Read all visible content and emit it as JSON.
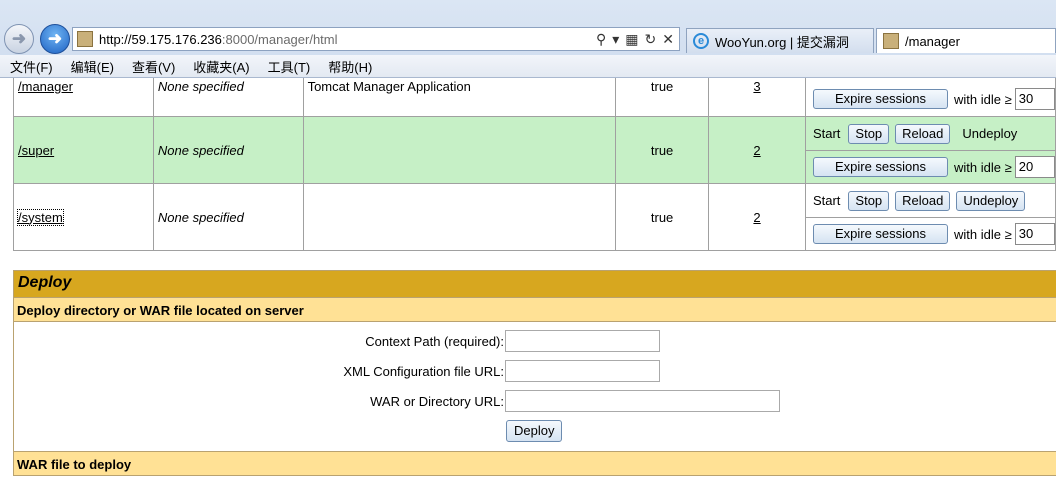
{
  "browser": {
    "url_host": "http://59.175.176.236",
    "url_rest": ":8000/manager/html",
    "tabs": [
      {
        "label": "WooYun.org | 提交漏洞"
      },
      {
        "label": "/manager"
      }
    ],
    "menu": [
      "文件(F)",
      "编辑(E)",
      "查看(V)",
      "收藏夹(A)",
      "工具(T)",
      "帮助(H)"
    ]
  },
  "apps": [
    {
      "path": "/manager",
      "version": "None specified",
      "name": "Tomcat Manager Application",
      "running": "true",
      "sessions": "3",
      "idle": "30"
    },
    {
      "path": "/super",
      "version": "None specified",
      "name": "",
      "running": "true",
      "sessions": "2",
      "idle": "20"
    },
    {
      "path": "/system",
      "version": "None specified",
      "name": "",
      "running": "true",
      "sessions": "2",
      "idle": "30"
    }
  ],
  "commands": {
    "start": "Start",
    "stop": "Stop",
    "reload": "Reload",
    "undeploy": "Undeploy",
    "expire": "Expire sessions",
    "with_idle": "with idle ≥"
  },
  "deploy": {
    "title": "Deploy",
    "server_section": "Deploy directory or WAR file located on server",
    "context_label": "Context Path (required):",
    "xml_label": "XML Configuration file URL:",
    "war_label": "WAR or Directory URL:",
    "deploy_button": "Deploy",
    "war_section": "WAR file to deploy"
  }
}
